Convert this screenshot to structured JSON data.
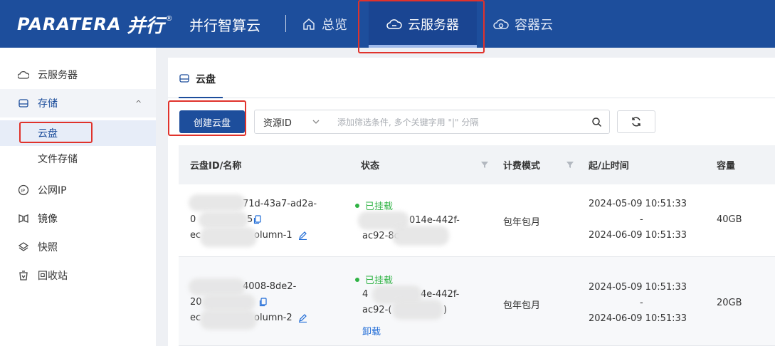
{
  "brand": {
    "logo_text": "PARATERA",
    "logo_cn": "并行",
    "logo_reg": "®",
    "product": "并行智算云"
  },
  "nav": {
    "overview": "总览",
    "cloud_server": "云服务器",
    "container_cloud": "容器云"
  },
  "sidebar": {
    "items": [
      {
        "label": "云服务器",
        "icon": "server-icon"
      },
      {
        "label": "存储",
        "icon": "storage-icon",
        "caret": "^"
      },
      {
        "label": "云盘"
      },
      {
        "label": "文件存储"
      },
      {
        "label": "公网IP",
        "icon": "ip-icon"
      },
      {
        "label": "镜像",
        "icon": "image-icon"
      },
      {
        "label": "快照",
        "icon": "snapshot-icon"
      },
      {
        "label": "回收站",
        "icon": "recycle-bin-icon"
      }
    ]
  },
  "main": {
    "tab": "云盘",
    "create_button": "创建云盘",
    "filter": {
      "key": "资源ID",
      "placeholder": "添加筛选条件, 多个关键字用 \"|\" 分隔"
    },
    "columns": [
      "云盘ID/名称",
      "状态",
      "计费模式",
      "起/止时间",
      "容量"
    ],
    "rows": [
      {
        "id_part": "71d-43a7-ad2a-",
        "id_line2": "0",
        "id_line2_tail": "5",
        "name_prefix": "ec",
        "name_suffix": "olumn-1",
        "status": "已挂载",
        "instance_line1": "014e-442f-",
        "instance_line2": "ac92-8c",
        "billing": "包年包月",
        "start": "2024-05-09 10:51:33",
        "dash": "-",
        "end": "2024-06-09 10:51:33",
        "capacity": "40GB"
      },
      {
        "id_part": "4008-8de2-",
        "id_line2": "20",
        "name_prefix": "ec",
        "name_suffix": "olumn-2",
        "status": "已挂载",
        "instance_line1_pre": "4",
        "instance_line1": "4e-442f-",
        "instance_line2": "ac92-(",
        "instance_line2_tail": ")",
        "action": "卸载",
        "billing": "包年包月",
        "start": "2024-05-09 10:51:33",
        "dash": "-",
        "end": "2024-06-09 10:51:33",
        "capacity": "20GB"
      }
    ]
  },
  "colors": {
    "topbar": "#1d4e9c",
    "accent": "#1d4e9c",
    "highlight_box": "#e0322b",
    "status_green": "#2fb344",
    "link": "#1d6ad6"
  }
}
